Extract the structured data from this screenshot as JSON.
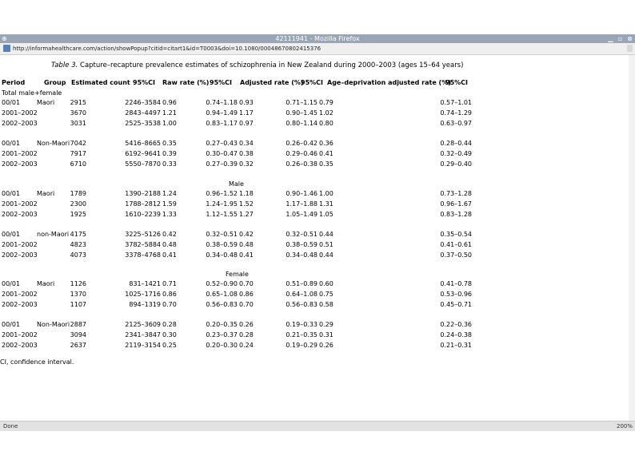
{
  "window": {
    "title": "42111941 - Mozilla Firefox",
    "controls": {
      "minimize": "▁",
      "maximize": "▫",
      "close": "⊗"
    }
  },
  "browser": {
    "url": "http://informahealthcare.com/action/showPopup?citid=citart1&id=T0003&doi=10.1080/00048670802415376",
    "status": "Done",
    "zoom": "200%"
  },
  "table": {
    "caption_label": "Table 3.",
    "caption_text": "Capture–recapture prevalence estimates of schizophrenia in New Zealand during 2000–2003 (ages 15–64 years)",
    "headers": [
      "Period",
      "Group",
      "Estimated count",
      "95%CI",
      "Raw rate (%)",
      "95%CI",
      "Adjusted rate (%)",
      "95%CI",
      "Age–deprivation adjusted rate (%)",
      "95%CI"
    ],
    "sections": [
      {
        "label": "Total male+female",
        "groups": [
          {
            "group": "Maori",
            "rows": [
              {
                "period": "00/01",
                "count": "2915",
                "ci": "2246–3584",
                "raw": "0.96",
                "raw_ci": "0.74–1.18",
                "adj": "0.93",
                "adj_ci": "0.71–1.15",
                "age": "0.79",
                "age_ci": "0.57–1.01"
              },
              {
                "period": "2001–2002",
                "count": "3670",
                "ci": "2843–4497",
                "raw": "1.21",
                "raw_ci": "0.94–1.49",
                "adj": "1.17",
                "adj_ci": "0.90–1.45",
                "age": "1.02",
                "age_ci": "0.74–1.29"
              },
              {
                "period": "2002–2003",
                "count": "3031",
                "ci": "2525–3538",
                "raw": "1.00",
                "raw_ci": "0.83–1.17",
                "adj": "0.97",
                "adj_ci": "0.80–1.14",
                "age": "0.80",
                "age_ci": "0.63–0.97"
              }
            ]
          },
          {
            "group": "Non-Maori",
            "rows": [
              {
                "period": "00/01",
                "count": "7042",
                "ci": "5416–8665",
                "raw": "0.35",
                "raw_ci": "0.27–0.43",
                "adj": "0.34",
                "adj_ci": "0.26–0.42",
                "age": "0.36",
                "age_ci": "0.28–0.44"
              },
              {
                "period": "2001–2002",
                "count": "7917",
                "ci": "6192–9641",
                "raw": "0.39",
                "raw_ci": "0.30–0.47",
                "adj": "0.38",
                "adj_ci": "0.29–0.46",
                "age": "0.41",
                "age_ci": "0.32–0.49"
              },
              {
                "period": "2002–2003",
                "count": "6710",
                "ci": "5550–7870",
                "raw": "0.33",
                "raw_ci": "0.27–0.39",
                "adj": "0.32",
                "adj_ci": "0.26–0.38",
                "age": "0.35",
                "age_ci": "0.29–0.40"
              }
            ]
          }
        ]
      },
      {
        "label": "Male",
        "groups": [
          {
            "group": "Maori",
            "rows": [
              {
                "period": "00/01",
                "count": "1789",
                "ci": "1390–2188",
                "raw": "1.24",
                "raw_ci": "0.96–1.52",
                "adj": "1.18",
                "adj_ci": "0.90–1.46",
                "age": "1.00",
                "age_ci": "0.73–1.28"
              },
              {
                "period": "2001–2002",
                "count": "2300",
                "ci": "1788–2812",
                "raw": "1.59",
                "raw_ci": "1.24–1.95",
                "adj": "1.52",
                "adj_ci": "1.17–1.88",
                "age": "1.31",
                "age_ci": "0.96–1.67"
              },
              {
                "period": "2002–2003",
                "count": "1925",
                "ci": "1610–2239",
                "raw": "1.33",
                "raw_ci": "1.12–1.55",
                "adj": "1.27",
                "adj_ci": "1.05–1.49",
                "age": "1.05",
                "age_ci": "0.83–1.28"
              }
            ]
          },
          {
            "group": "non-Maori",
            "rows": [
              {
                "period": "00/01",
                "count": "4175",
                "ci": "3225–5126",
                "raw": "0.42",
                "raw_ci": "0.32–0.51",
                "adj": "0.42",
                "adj_ci": "0.32–0.51",
                "age": "0.44",
                "age_ci": "0.35–0.54"
              },
              {
                "period": "2001–2002",
                "count": "4823",
                "ci": "3782–5884",
                "raw": "0.48",
                "raw_ci": "0.38–0.59",
                "adj": "0.48",
                "adj_ci": "0.38–0.59",
                "age": "0.51",
                "age_ci": "0.41–0.61"
              },
              {
                "period": "2002–2003",
                "count": "4073",
                "ci": "3378–4768",
                "raw": "0.41",
                "raw_ci": "0.34–0.48",
                "adj": "0.41",
                "adj_ci": "0.34–0.48",
                "age": "0.44",
                "age_ci": "0.37–0.50"
              }
            ]
          }
        ]
      },
      {
        "label": "Female",
        "groups": [
          {
            "group": "Maori",
            "rows": [
              {
                "period": "00/01",
                "count": "1126",
                "ci": "831–1421",
                "raw": "0.71",
                "raw_ci": "0.52–0.90",
                "adj": "0.70",
                "adj_ci": "0.51–0.89",
                "age": "0.60",
                "age_ci": "0.41–0.78"
              },
              {
                "period": "2001–2002",
                "count": "1370",
                "ci": "1025–1716",
                "raw": "0.86",
                "raw_ci": "0.65–1.08",
                "adj": "0.86",
                "adj_ci": "0.64–1.08",
                "age": "0.75",
                "age_ci": "0.53–0.96"
              },
              {
                "period": "2002–2003",
                "count": "1107",
                "ci": "894–1319",
                "raw": "0.70",
                "raw_ci": "0.56–0.83",
                "adj": "0.70",
                "adj_ci": "0.56–0.83",
                "age": "0.58",
                "age_ci": "0.45–0.71"
              }
            ]
          },
          {
            "group": "Non-Maori",
            "rows": [
              {
                "period": "00/01",
                "count": "2887",
                "ci": "2125–3609",
                "raw": "0.28",
                "raw_ci": "0.20–0.35",
                "adj": "0.26",
                "adj_ci": "0.19–0.33",
                "age": "0.29",
                "age_ci": "0.22–0.36"
              },
              {
                "period": "2001–2002",
                "count": "3094",
                "ci": "2341–3847",
                "raw": "0.30",
                "raw_ci": "0.23–0.37",
                "adj": "0.28",
                "adj_ci": "0.21–0.35",
                "age": "0.31",
                "age_ci": "0.24–0.38"
              },
              {
                "period": "2002–2003",
                "count": "2637",
                "ci": "2119–3154",
                "raw": "0.25",
                "raw_ci": "0.20–0.30",
                "adj": "0.24",
                "adj_ci": "0.19–0.29",
                "age": "0.26",
                "age_ci": "0.21–0.31"
              }
            ]
          }
        ]
      }
    ],
    "footnote": "CI, confidence interval."
  }
}
